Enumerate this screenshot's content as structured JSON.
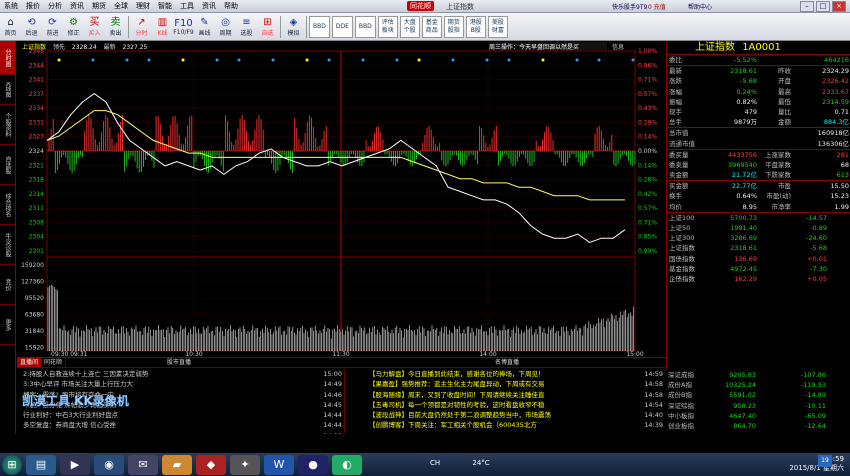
{
  "menubar": {
    "items": [
      "系统",
      "报价",
      "分析",
      "资讯",
      "期货",
      "全球",
      "理财",
      "智能",
      "工具",
      "资讯",
      "帮助"
    ],
    "brand": "同花顺",
    "window_title": "上证指数",
    "product": "快乐股手9T9",
    "account": "0 充值",
    "help": "帮助中心"
  },
  "toolbar": {
    "items": [
      {
        "icon": "⌂",
        "label": "首页"
      },
      {
        "icon": "⟲",
        "label": "后退"
      },
      {
        "icon": "⟳",
        "label": "前进"
      },
      {
        "icon": "⚙",
        "label": "修正"
      },
      {
        "icon": "买",
        "label": "买入"
      },
      {
        "icon": "卖",
        "label": "卖出"
      },
      {
        "icon": "↗",
        "label": "分时"
      },
      {
        "icon": "▥",
        "label": "K线"
      },
      {
        "icon": "F10",
        "label": "F10/F9"
      },
      {
        "icon": "✎",
        "label": "画线"
      },
      {
        "icon": "◎",
        "label": "周期"
      },
      {
        "icon": "≡",
        "label": "选股"
      },
      {
        "icon": "⊞",
        "label": "自选"
      },
      {
        "icon": "◈",
        "label": "模拟"
      }
    ],
    "boxes": [
      {
        "top": "BBD",
        "bottom": ""
      },
      {
        "top": "DDE",
        "bottom": ""
      },
      {
        "top": "BBD",
        "bottom": ""
      },
      {
        "top": "评估",
        "bottom": "板块"
      },
      {
        "top": "大盘",
        "bottom": "个股"
      },
      {
        "top": "基金",
        "bottom": "商品"
      },
      {
        "top": "期货",
        "bottom": "股指"
      },
      {
        "top": "港股",
        "bottom": "B股"
      },
      {
        "top": "美股",
        "bottom": "财富"
      }
    ]
  },
  "lefttabs": [
    "分时图",
    "K线图",
    "个股资料",
    "自选股",
    "综合排名",
    "牛叉诊股",
    "竞价",
    "更多"
  ],
  "chart_legend": {
    "name": "上证指数",
    "mode": "领先",
    "price": "2328.24",
    "avg_label": "最新",
    "avg": "2327.25",
    "notice": "周三操作：今天早盘回调以然是买",
    "info": "信息"
  },
  "chart_data": {
    "type": "line",
    "title": "上证指数",
    "x_ticks": [
      "09:30 09:31",
      "10:30",
      "11:30",
      "14:00",
      "15:00"
    ],
    "y_ticks_left": [
      "2348",
      "2344",
      "2341",
      "2337",
      "2334",
      "2331",
      "2327",
      "2324",
      "2321",
      "2318",
      "2314",
      "2311",
      "2308",
      "2304",
      "2301"
    ],
    "y_ticks_right": [
      "1.00%",
      "0.86%",
      "0.71%",
      "0.57%",
      "0.43%",
      "0.29%",
      "0.14%",
      "0.00%",
      "0.14%",
      "0.28%",
      "0.42%",
      "0.57%",
      "0.71%",
      "0.85%",
      "0.99%"
    ],
    "prev_close": 2324.29,
    "ylim": [
      2301,
      2348
    ],
    "series": [
      {
        "name": "价格",
        "color": "#ffffff",
        "values": [
          2327,
          2329,
          2333,
          2336,
          2338,
          2336,
          2331,
          2327,
          2325,
          2323,
          2321,
          2322,
          2321,
          2320,
          2321,
          2319,
          2321,
          2322,
          2324,
          2325,
          2323,
          2322,
          2321,
          2321,
          2322,
          2321,
          2322,
          2323,
          2324,
          2325,
          2327,
          2325,
          2323,
          2321,
          2316,
          2315,
          2314,
          2313,
          2313,
          2312,
          2310,
          2307,
          2305,
          2304,
          2304,
          2305,
          2303,
          2304,
          2304,
          2306
        ]
      },
      {
        "name": "均价",
        "color": "#ffff66",
        "values": [
          2327,
          2328,
          2330,
          2332,
          2334,
          2334,
          2333,
          2331,
          2329,
          2327,
          2326,
          2325,
          2324,
          2324,
          2323,
          2323,
          2323,
          2323,
          2323,
          2323,
          2323,
          2323,
          2323,
          2323,
          2323,
          2323,
          2323,
          2323,
          2323,
          2323,
          2323,
          2322,
          2321,
          2320,
          2319,
          2318,
          2318,
          2317,
          2317,
          2317,
          2316,
          2316,
          2315,
          2314,
          2314,
          2314,
          2313,
          2313,
          2313,
          2313
        ]
      }
    ],
    "volume_ticks": [
      "159200",
      "127360",
      "95520",
      "63680",
      "31840",
      "15920"
    ]
  },
  "quote": {
    "title": "上证指数",
    "code": "1A0001",
    "rows": [
      {
        "l": "委比",
        "v": "-5.52%",
        "vc": "grn",
        "l2": "",
        "v2": "464216",
        "v2c": "grn"
      },
      {
        "l": "最新",
        "v": "2318.61",
        "vc": "grn",
        "l2": "昨收",
        "v2": "2324.29",
        "v2c": "wht"
      },
      {
        "l": "涨跌",
        "v": "-5.68",
        "vc": "grn",
        "l2": "开盘",
        "v2": "2326.42",
        "v2c": "red"
      },
      {
        "l": "涨幅",
        "v": "0.24%",
        "vc": "grn",
        "l2": "最高",
        "v2": "2333.67",
        "v2c": "red"
      },
      {
        "l": "振幅",
        "v": "0.82%",
        "vc": "wht",
        "l2": "最低",
        "v2": "2314.59",
        "v2c": "grn"
      },
      {
        "l": "现手",
        "v": "479",
        "vc": "wht",
        "l2": "量比",
        "v2": "0.71",
        "v2c": "wht"
      },
      {
        "l": "总手",
        "v": "9879万",
        "vc": "wht",
        "l2": "金额",
        "v2": "884.3亿",
        "v2c": "cyn"
      },
      {
        "l": "总市值",
        "v": "",
        "vc": "wht",
        "l2": "",
        "v2": "160918亿",
        "v2c": "wht"
      },
      {
        "l": "流通市值",
        "v": "",
        "vc": "wht",
        "l2": "",
        "v2": "136306亿",
        "v2c": "wht"
      },
      {
        "l": "委买量",
        "v": "4433756",
        "vc": "red",
        "l2": "上涨家数",
        "v2": "281",
        "v2c": "red"
      },
      {
        "l": "委卖量",
        "v": "3969540",
        "vc": "grn",
        "l2": "平盘家数",
        "v2": "68",
        "v2c": "wht"
      },
      {
        "l": "卖金额",
        "v": "21.72亿",
        "vc": "cyn",
        "l2": "下跌家数",
        "v2": "613",
        "v2c": "grn"
      },
      {
        "l": "买金额",
        "v": "22.77亿",
        "vc": "cyn",
        "l2": "市盈",
        "v2": "15.50",
        "v2c": "wht"
      },
      {
        "l": "换手",
        "v": "0.64%",
        "vc": "wht",
        "l2": "市盈(动)",
        "v2": "15.23",
        "v2c": "wht"
      },
      {
        "l": "均价",
        "v": "8.95",
        "vc": "wht",
        "l2": "市净率",
        "v2": "1.99",
        "v2c": "wht"
      }
    ],
    "indices": [
      {
        "l": "上证100",
        "v": "5700.73",
        "c": "-14.57",
        "vc": "grn"
      },
      {
        "l": "上证50",
        "v": "1981.40",
        "c": "-0.89",
        "vc": "grn"
      },
      {
        "l": "上证300",
        "v": "3286.69",
        "c": "-24.60",
        "vc": "grn"
      },
      {
        "l": "上证指数",
        "v": "2318.61",
        "c": "-5.68",
        "vc": "grn"
      },
      {
        "l": "国债指数",
        "v": "136.69",
        "c": "+0.01",
        "vc": "red"
      },
      {
        "l": "基金指数",
        "v": "4972.45",
        "c": "-7.30",
        "vc": "grn"
      },
      {
        "l": "企债指数",
        "v": "162.29",
        "c": "+0.05",
        "vc": "red"
      }
    ],
    "indices2": [
      {
        "l": "深证成指",
        "v": "9205.83",
        "c": "-107.86",
        "vc": "grn"
      },
      {
        "l": "成份A指",
        "v": "10325.24",
        "c": "-119.93",
        "vc": "grn"
      },
      {
        "l": "成份B指",
        "v": "5591.02",
        "c": "-14.89",
        "vc": "grn"
      },
      {
        "l": "深证综指",
        "v": "958.23",
        "c": "-10.11",
        "vc": "grn"
      },
      {
        "l": "中小板指",
        "v": "4647.40",
        "c": "-65.09",
        "vc": "grn"
      },
      {
        "l": "创业板指",
        "v": "864.70",
        "c": "-12.64",
        "vc": "grn"
      }
    ]
  },
  "news": {
    "tab_active": "直播间",
    "tab2": "同花顺",
    "left_header": "股市直播",
    "right_header": "名博直播",
    "left": [
      {
        "txt": "2:持股人自救连续十上连亡 三因素决定弱势",
        "t": "15:00"
      },
      {
        "txt": "3:3中心早评 市场关注大量上行压力大",
        "t": "14:49"
      },
      {
        "txt": "博客：震荡！股市将有夺命一灾",
        "t": "14:46"
      },
      {
        "txt": "个股严重分化 热帖散步再起资涌",
        "t": "14:45"
      },
      {
        "txt": "行业利好：中石3大行业利好盘点",
        "t": "14:44"
      },
      {
        "txt": "多空复盘：券商盘大增 信心受挫",
        "t": "14:44"
      },
      {
        "txt": "",
        "t": "14:39"
      }
    ],
    "right": [
      {
        "tl": "",
        "txt": "【马力解盘】今日直播到此结束，感谢各位的捧场，下周见！",
        "t": "14:59"
      },
      {
        "tl": "",
        "txt": "【果嘉盈】强势推荐：蓝主生化主力尾盘异动，下周或有交易",
        "t": "14:58"
      },
      {
        "tl": "",
        "txt": "【股海随缘】周末，又到了收盘时间！下周请继续关注睡佳直",
        "t": "14:58"
      },
      {
        "tl": "",
        "txt": "【五毒司机】每一个顶都是对韧性的考验，这时看盘收窄不稳",
        "t": "14:54"
      },
      {
        "tl": "",
        "txt": "【波段战神】目前大盘仍然处于第二浪调整趋势当中，市场震荡",
        "t": "14:40"
      },
      {
        "tl": "",
        "txt": "【创鹏博客】下周关注：军工相关个股机会（600435北方",
        "t": "14:39"
      }
    ]
  },
  "watermark": "凯漠工具 KK录像机",
  "taskbar": {
    "tray_lang": "CH",
    "temp": "24°C",
    "time": "6:59",
    "date": "2015/8/1 星期六",
    "badge": "19"
  }
}
